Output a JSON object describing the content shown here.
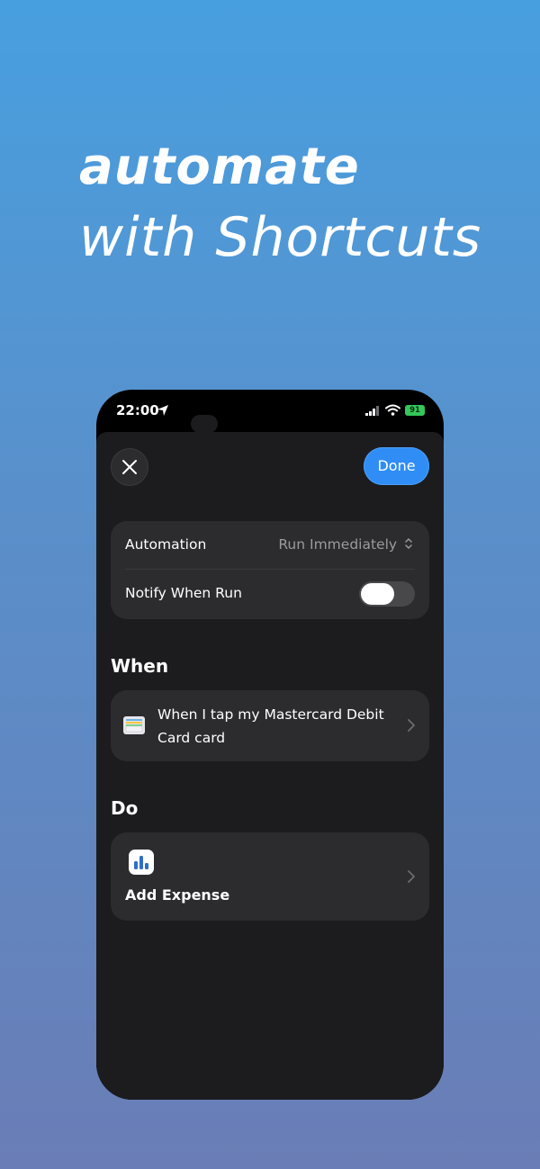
{
  "headline": {
    "line1": "automate",
    "line2": "with Shortcuts"
  },
  "statusbar": {
    "time": "22:00",
    "battery": "91"
  },
  "sheet": {
    "done_label": "Done",
    "settings": {
      "automation_label": "Automation",
      "automation_value": "Run Immediately",
      "notify_label": "Notify When Run",
      "notify_on": false
    },
    "when": {
      "title": "When",
      "text": "When I tap my Mastercard Debit Card card"
    },
    "do": {
      "title": "Do",
      "action": "Add Expense"
    }
  },
  "colors": {
    "accent": "#2f8df5",
    "sheet_bg": "#1c1c1e",
    "card_bg": "#2c2c2e",
    "battery": "#34c759"
  },
  "icons": [
    "location-arrow-icon",
    "signal-icon",
    "wifi-icon",
    "battery-icon",
    "close-icon",
    "up-down-chevron-icon",
    "wallet-icon",
    "chevron-right-icon",
    "bar-chart-app-icon"
  ]
}
